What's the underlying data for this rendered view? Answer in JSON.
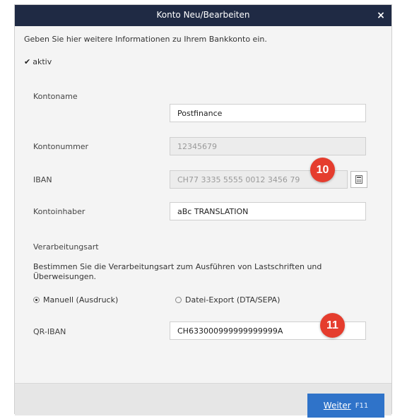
{
  "dialog": {
    "title": "Konto Neu/Bearbeiten",
    "close_label": "×"
  },
  "intro": "Geben Sie hier weitere Informationen zu Ihrem Bankkonto ein.",
  "aktiv": {
    "label": "aktiv",
    "checked": true
  },
  "fields": {
    "kontoname": {
      "label": "Kontoname",
      "value": "Postfinance"
    },
    "kontonummer": {
      "label": "Kontonummer",
      "value": "12345679"
    },
    "iban": {
      "label": "IBAN",
      "value": "CH77 3335 5555 0012 3456 79"
    },
    "kontoinhaber": {
      "label": "Kontoinhaber",
      "value": "aBc TRANSLATION"
    },
    "qriban": {
      "label": "QR-IBAN",
      "value": "CH633000999999999999A"
    }
  },
  "verarbeitung": {
    "title": "Verarbeitungsart",
    "description": "Bestimmen Sie die Verarbeitungsart zum Ausführen von Lastschriften und Überweisungen.",
    "option_manual": "Manuell (Ausdruck)",
    "option_export": "Datei-Export (DTA/SEPA)",
    "selected": "Manuell (Ausdruck)"
  },
  "badges": {
    "b10": "10",
    "b11": "11"
  },
  "footer": {
    "weiter_label": "Weiter",
    "weiter_shortcut": "F11"
  },
  "colors": {
    "titlebar": "#1f2a44",
    "button": "#2f73c9",
    "badge": "#e53d2e"
  }
}
